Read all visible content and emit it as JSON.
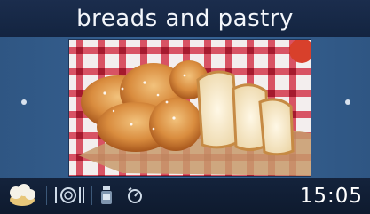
{
  "header": {
    "title": "breads and pastry"
  },
  "main": {
    "photo": {
      "subject": "braided bread on checkered cloth"
    }
  },
  "toolbar": {
    "items": [
      {
        "icon": "chef-hat-icon"
      },
      {
        "icon": "plate-cutlery-icon"
      },
      {
        "icon": "food-jar-icon"
      },
      {
        "icon": "timer-icon"
      }
    ]
  },
  "status": {
    "time": "15:05"
  },
  "colors": {
    "header_bg": "#132440",
    "main_bg": "#386496",
    "footer_bg": "#0e1a2e",
    "text": "#ffffff"
  }
}
